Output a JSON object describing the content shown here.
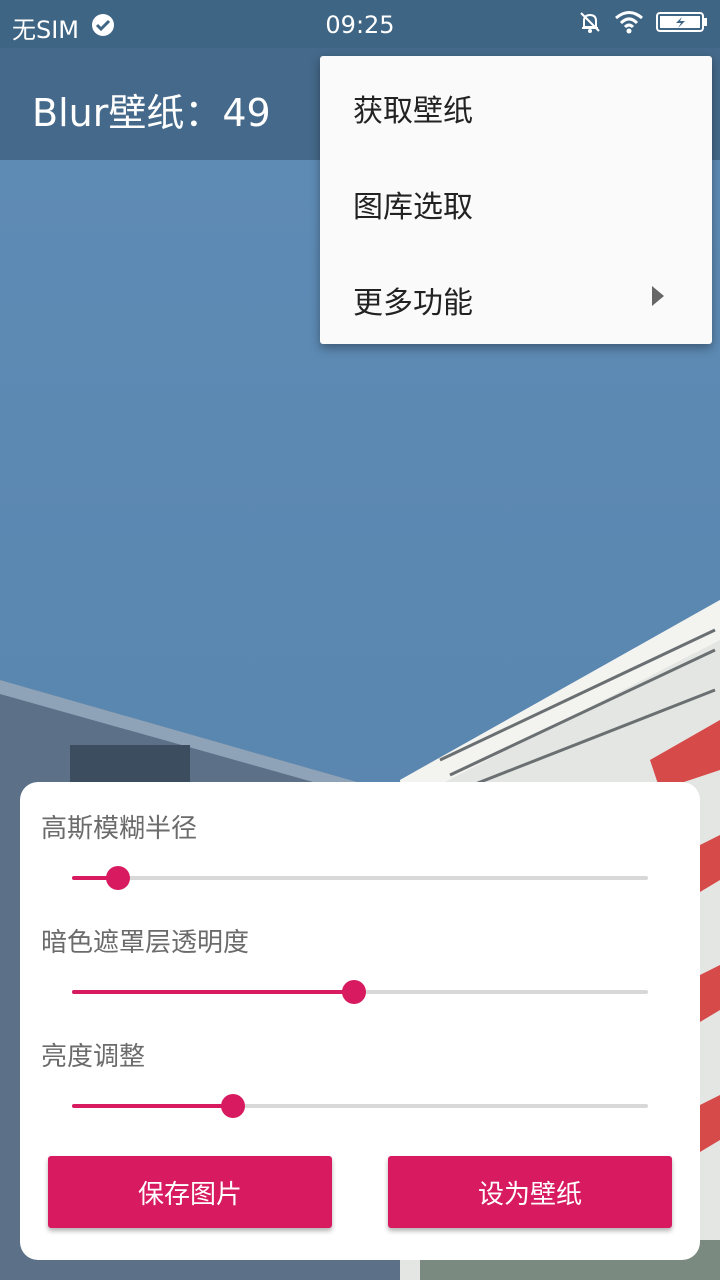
{
  "status_bar": {
    "carrier": "无SIM",
    "time": "09:25"
  },
  "app_bar": {
    "title": "Blur壁纸：49"
  },
  "menu": {
    "items": [
      {
        "label": "获取壁纸",
        "has_submenu": false
      },
      {
        "label": "图库选取",
        "has_submenu": false
      },
      {
        "label": "更多功能",
        "has_submenu": true
      }
    ]
  },
  "controls": {
    "blur_radius": {
      "label": "高斯模糊半径",
      "value_fraction": 0.08
    },
    "dark_overlay": {
      "label": "暗色遮罩层透明度",
      "value_fraction": 0.49
    },
    "brightness": {
      "label": "亮度调整",
      "value_fraction": 0.28
    }
  },
  "buttons": {
    "save": "保存图片",
    "set_wallpaper": "设为壁纸"
  },
  "colors": {
    "accent": "#d81b60",
    "status_bar": "#3f6585",
    "app_bar": "#45698a",
    "sky": "#5a86b0"
  },
  "icons": [
    "check-circle-icon",
    "mute-icon",
    "wifi-icon",
    "battery-charging-icon",
    "submenu-arrow-icon"
  ]
}
